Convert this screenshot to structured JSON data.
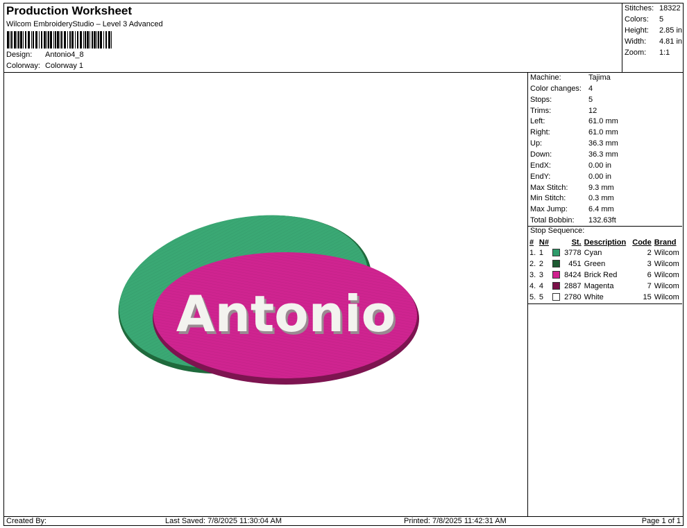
{
  "header": {
    "title": "Production Worksheet",
    "subtitle": "Wilcom EmbroideryStudio – Level 3 Advanced",
    "design_label": "Design:",
    "design_value": "Antonio4_8",
    "colorway_label": "Colorway:",
    "colorway_value": "Colorway 1"
  },
  "summary": [
    {
      "label": "Stitches:",
      "value": "18322"
    },
    {
      "label": "Colors:",
      "value": "5"
    },
    {
      "label": "Height:",
      "value": "2.85 in"
    },
    {
      "label": "Width:",
      "value": "4.81 in"
    },
    {
      "label": "Zoom:",
      "value": "1:1"
    }
  ],
  "machine_info": [
    {
      "label": "Machine:",
      "value": "Tajima"
    },
    {
      "label": "Color changes:",
      "value": "4"
    },
    {
      "label": "Stops:",
      "value": "5"
    },
    {
      "label": "Trims:",
      "value": "12"
    },
    {
      "label": "Left:",
      "value": "61.0 mm"
    },
    {
      "label": "Right:",
      "value": "61.0 mm"
    },
    {
      "label": "Up:",
      "value": "36.3 mm"
    },
    {
      "label": "Down:",
      "value": "36.3 mm"
    },
    {
      "label": "EndX:",
      "value": "0.00 in"
    },
    {
      "label": "EndY:",
      "value": "0.00 in"
    },
    {
      "label": "Max Stitch:",
      "value": "9.3 mm"
    },
    {
      "label": "Min Stitch:",
      "value": "0.3 mm"
    },
    {
      "label": "Max Jump:",
      "value": "6.4 mm"
    },
    {
      "label": "Total Bobbin:",
      "value": "132.63ft"
    }
  ],
  "stop_sequence": {
    "heading": "Stop Sequence:",
    "columns": {
      "num": "#",
      "n": "N#",
      "st": "St.",
      "desc": "Description",
      "code": "Code",
      "brand": "Brand"
    },
    "rows": [
      {
        "num": "1.",
        "n": "1",
        "color": "#2e9b6a",
        "st": "3778",
        "desc": "Cyan",
        "code": "2",
        "brand": "Wilcom"
      },
      {
        "num": "2.",
        "n": "2",
        "color": "#1d5a32",
        "st": "451",
        "desc": "Green",
        "code": "3",
        "brand": "Wilcom"
      },
      {
        "num": "3.",
        "n": "3",
        "color": "#d0208e",
        "st": "8424",
        "desc": "Brick Red",
        "code": "6",
        "brand": "Wilcom"
      },
      {
        "num": "4.",
        "n": "4",
        "color": "#7a1048",
        "st": "2887",
        "desc": "Magenta",
        "code": "7",
        "brand": "Wilcom"
      },
      {
        "num": "5.",
        "n": "5",
        "color": "#ffffff",
        "st": "2780",
        "desc": "White",
        "code": "15",
        "brand": "Wilcom"
      }
    ]
  },
  "design_preview": {
    "text": "Antonio",
    "colors": {
      "back_oval": "#3aa874",
      "back_oval_edge": "#1f6a3c",
      "front_oval": "#cf2490",
      "front_oval_edge": "#7d1450",
      "lettering": "#f3f3ef"
    }
  },
  "footer": {
    "created_by": "Created By:",
    "last_saved": "Last Saved: 7/8/2025 11:30:04 AM",
    "printed": "Printed: 7/8/2025 11:42:31 AM",
    "page": "Page 1 of 1"
  }
}
